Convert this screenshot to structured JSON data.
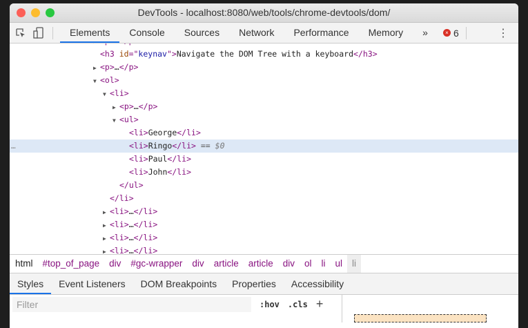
{
  "window": {
    "title": "DevTools - localhost:8080/web/tools/chrome-devtools/dom/"
  },
  "toolbar": {
    "tabs": [
      "Elements",
      "Console",
      "Sources",
      "Network",
      "Performance",
      "Memory"
    ],
    "active": "Elements",
    "overflow": "»",
    "error_count": "6",
    "colors": {
      "accent": "#1a73e8",
      "error": "#d93025"
    }
  },
  "tree": {
    "lines": [
      {
        "depth": 0,
        "arrow": "right",
        "tokens": [
          [
            "tg",
            "<p>"
          ],
          [
            "tx",
            "…"
          ],
          [
            "tg",
            "</p>"
          ]
        ]
      },
      {
        "depth": 0,
        "arrow": "",
        "tokens": [
          [
            "tg",
            "<h3"
          ],
          [
            "an",
            " id"
          ],
          [
            "tg",
            "=\""
          ],
          [
            "av",
            "keynav"
          ],
          [
            "tg",
            "\">"
          ],
          [
            "tx",
            "Navigate the DOM Tree with a keyboard"
          ],
          [
            "tg",
            "</h3>"
          ]
        ]
      },
      {
        "depth": 0,
        "arrow": "right",
        "tokens": [
          [
            "tg",
            "<p>"
          ],
          [
            "tx",
            "…"
          ],
          [
            "tg",
            "</p>"
          ]
        ]
      },
      {
        "depth": 0,
        "arrow": "down",
        "tokens": [
          [
            "tg",
            "<ol>"
          ]
        ]
      },
      {
        "depth": 1,
        "arrow": "down",
        "tokens": [
          [
            "tg",
            "<li>"
          ]
        ]
      },
      {
        "depth": 2,
        "arrow": "right",
        "tokens": [
          [
            "tg",
            "<p>"
          ],
          [
            "tx",
            "…"
          ],
          [
            "tg",
            "</p>"
          ]
        ]
      },
      {
        "depth": 2,
        "arrow": "down",
        "tokens": [
          [
            "tg",
            "<ul>"
          ]
        ]
      },
      {
        "depth": 3,
        "arrow": "",
        "tokens": [
          [
            "tg",
            "<li>"
          ],
          [
            "tx",
            "George"
          ],
          [
            "tg",
            "</li>"
          ]
        ]
      },
      {
        "depth": 3,
        "arrow": "",
        "selected": true,
        "tokens": [
          [
            "tg",
            "<li>"
          ],
          [
            "tx",
            "Ringo"
          ],
          [
            "tg",
            "</li>"
          ],
          [
            "eq",
            " == "
          ],
          [
            "dv",
            "$0"
          ]
        ]
      },
      {
        "depth": 3,
        "arrow": "",
        "tokens": [
          [
            "tg",
            "<li>"
          ],
          [
            "tx",
            "Paul"
          ],
          [
            "tg",
            "</li>"
          ]
        ]
      },
      {
        "depth": 3,
        "arrow": "",
        "tokens": [
          [
            "tg",
            "<li>"
          ],
          [
            "tx",
            "John"
          ],
          [
            "tg",
            "</li>"
          ]
        ]
      },
      {
        "depth": 2,
        "arrow": "",
        "tokens": [
          [
            "tg",
            "</ul>"
          ]
        ]
      },
      {
        "depth": 1,
        "arrow": "",
        "tokens": [
          [
            "tg",
            "</li>"
          ]
        ]
      },
      {
        "depth": 1,
        "arrow": "right",
        "tokens": [
          [
            "tg",
            "<li>"
          ],
          [
            "tx",
            "…"
          ],
          [
            "tg",
            "</li>"
          ]
        ]
      },
      {
        "depth": 1,
        "arrow": "right",
        "tokens": [
          [
            "tg",
            "<li>"
          ],
          [
            "tx",
            "…"
          ],
          [
            "tg",
            "</li>"
          ]
        ]
      },
      {
        "depth": 1,
        "arrow": "right",
        "tokens": [
          [
            "tg",
            "<li>"
          ],
          [
            "tx",
            "…"
          ],
          [
            "tg",
            "</li>"
          ]
        ]
      },
      {
        "depth": 1,
        "arrow": "right",
        "tokens": [
          [
            "tg",
            "<li>"
          ],
          [
            "tx",
            "…"
          ],
          [
            "tg",
            "</li>"
          ]
        ]
      }
    ],
    "gutter": "…"
  },
  "breadcrumbs": [
    "html",
    "#top_of_page",
    "div",
    "#gc-wrapper",
    "div",
    "article",
    "article",
    "div",
    "ol",
    "li",
    "ul",
    "li"
  ],
  "subtabs": [
    "Styles",
    "Event Listeners",
    "DOM Breakpoints",
    "Properties",
    "Accessibility"
  ],
  "styles": {
    "filter_placeholder": "Filter",
    "hov": ":hov",
    "cls": ".cls",
    "add": "+"
  }
}
